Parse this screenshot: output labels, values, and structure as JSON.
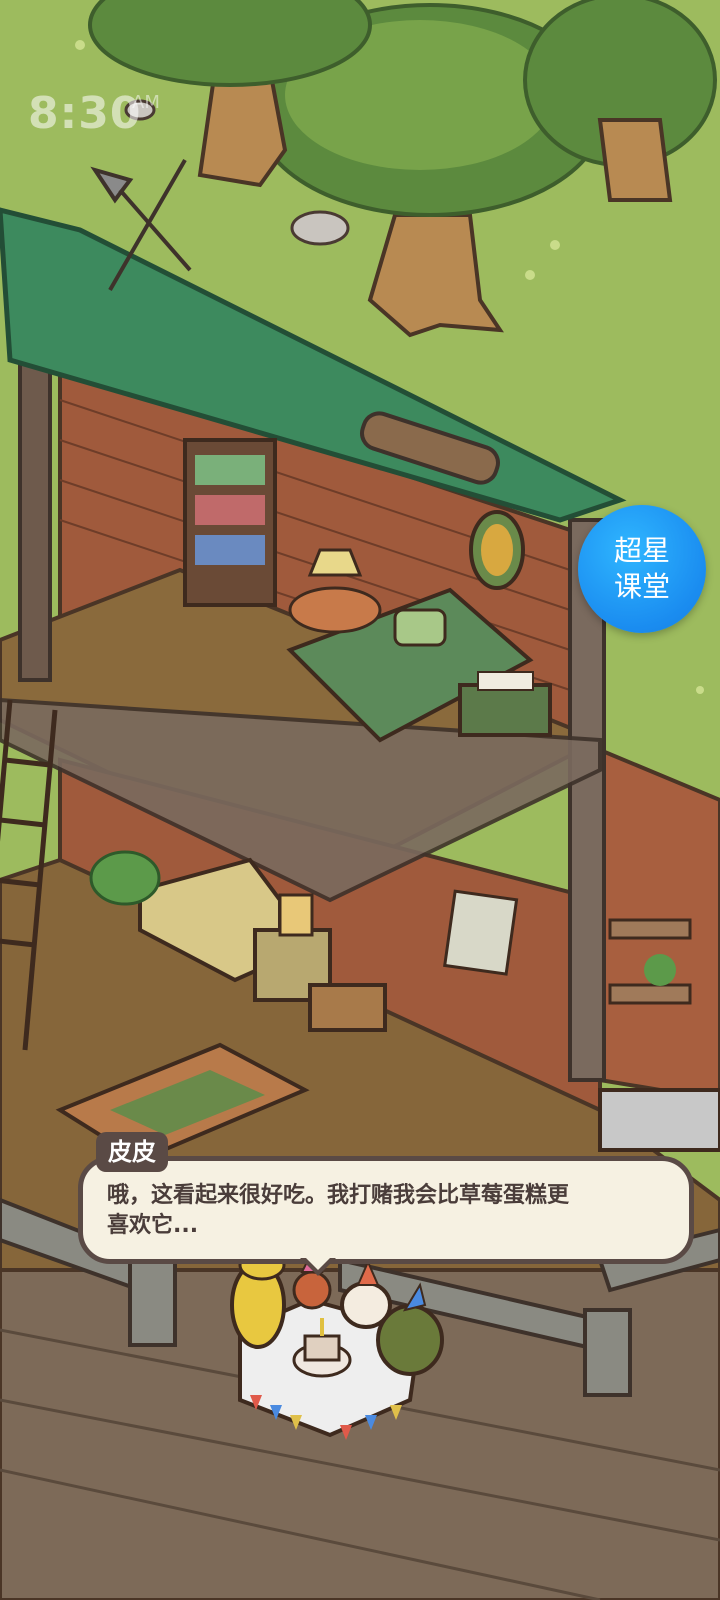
{
  "status_bar": {
    "time": "8:30",
    "ampm": "AM"
  },
  "fab": {
    "line1": "超星",
    "line2": "课堂",
    "color": "#1a8cf0"
  },
  "dialogue": {
    "speaker": "皮皮",
    "line1": "哦，这看起来很好吃。我打赌我会比草莓蛋糕更",
    "line2": "喜欢它..."
  },
  "colors": {
    "grass": "#9dbb5e",
    "wood_floor": "#8a6a3c",
    "brick": "#a05a3c",
    "roof": "#3d8a5e",
    "bubble_fill": "#f6f1e2",
    "bubble_border": "#5a4a45"
  }
}
